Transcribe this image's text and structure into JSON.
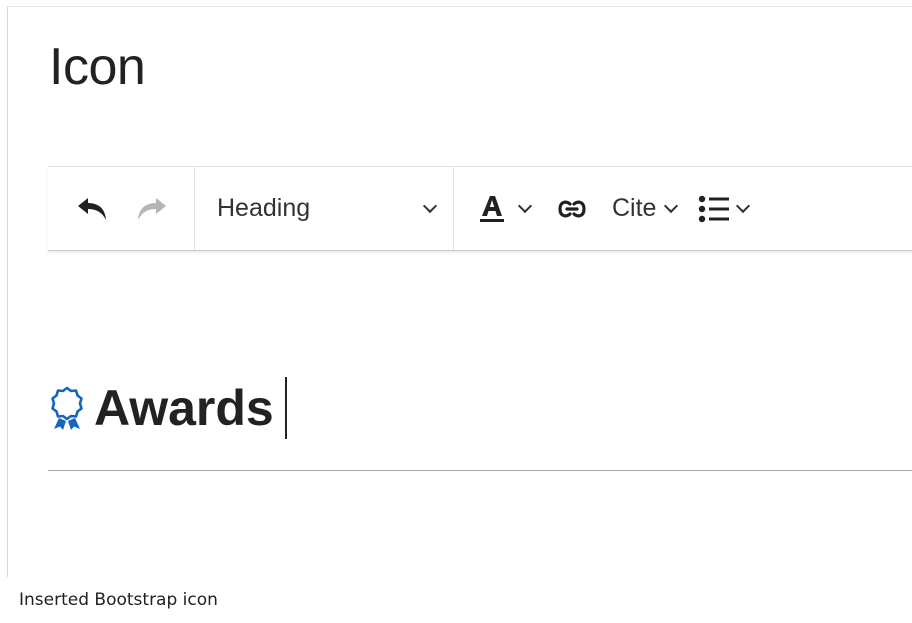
{
  "page": {
    "title": "Icon"
  },
  "toolbar": {
    "undo_icon": "undo-arrow-icon",
    "redo_icon": "redo-arrow-icon",
    "format_label": "Heading",
    "style_icon": "text-style-icon",
    "link_icon": "link-icon",
    "cite_label": "Cite",
    "list_icon": "bullet-list-icon"
  },
  "content": {
    "icon": "award-icon",
    "icon_color": "#1565c0",
    "heading": "Awards"
  },
  "caption": "Inserted Bootstrap icon"
}
